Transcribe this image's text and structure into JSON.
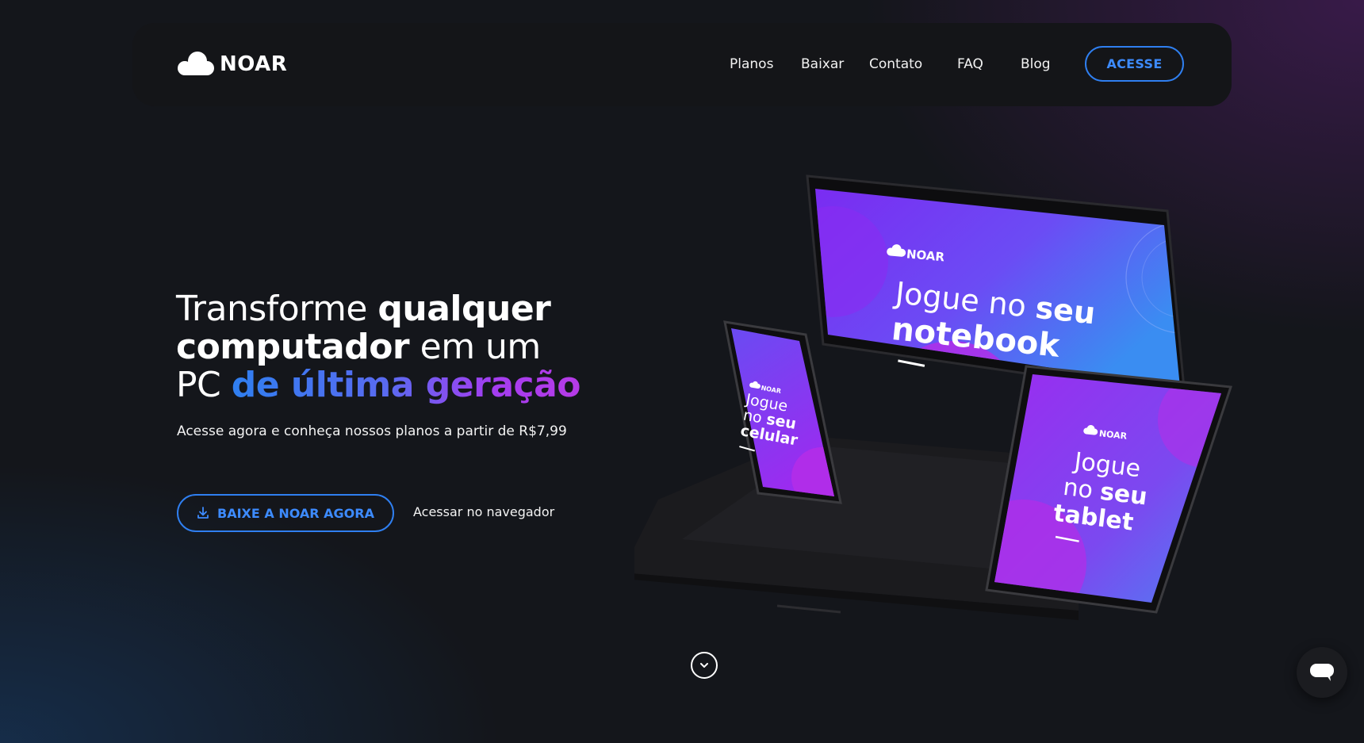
{
  "header": {
    "brand": "NOAR",
    "nav": [
      "Planos",
      "Baixar",
      "Contato",
      "FAQ",
      "Blog"
    ],
    "cta_label": "ACESSE"
  },
  "hero": {
    "title_parts": {
      "p1": "Transforme ",
      "p2": "qualquer",
      "p3": "computador",
      "p4": " em um",
      "p5": "PC ",
      "p6": "de última geração"
    },
    "subtitle": "Acesse agora e conheça nossos planos a partir de R$7,99",
    "download_label": "BAIXE A NOAR AGORA",
    "browser_label": "Acessar no navegador"
  },
  "devices": {
    "brand": "NOAR",
    "laptop_screen": {
      "line1": "Jogue no",
      "line1_bold": "seu",
      "line2": "notebook"
    },
    "phone_screen": {
      "line1": "Jogue",
      "line2": "no",
      "line2_bold": "seu",
      "line3": "celular"
    },
    "tablet_screen": {
      "line1": "Jogue",
      "line2": "no",
      "line2_bold": "seu",
      "line3": "tablet"
    }
  },
  "icons": {
    "download": "download-icon",
    "scroll": "chevron-down-icon",
    "chat": "chat-icon"
  },
  "colors": {
    "accent_blue": "#2f7ff0",
    "accent_purple": "#a43df0",
    "background": "#14161b"
  }
}
